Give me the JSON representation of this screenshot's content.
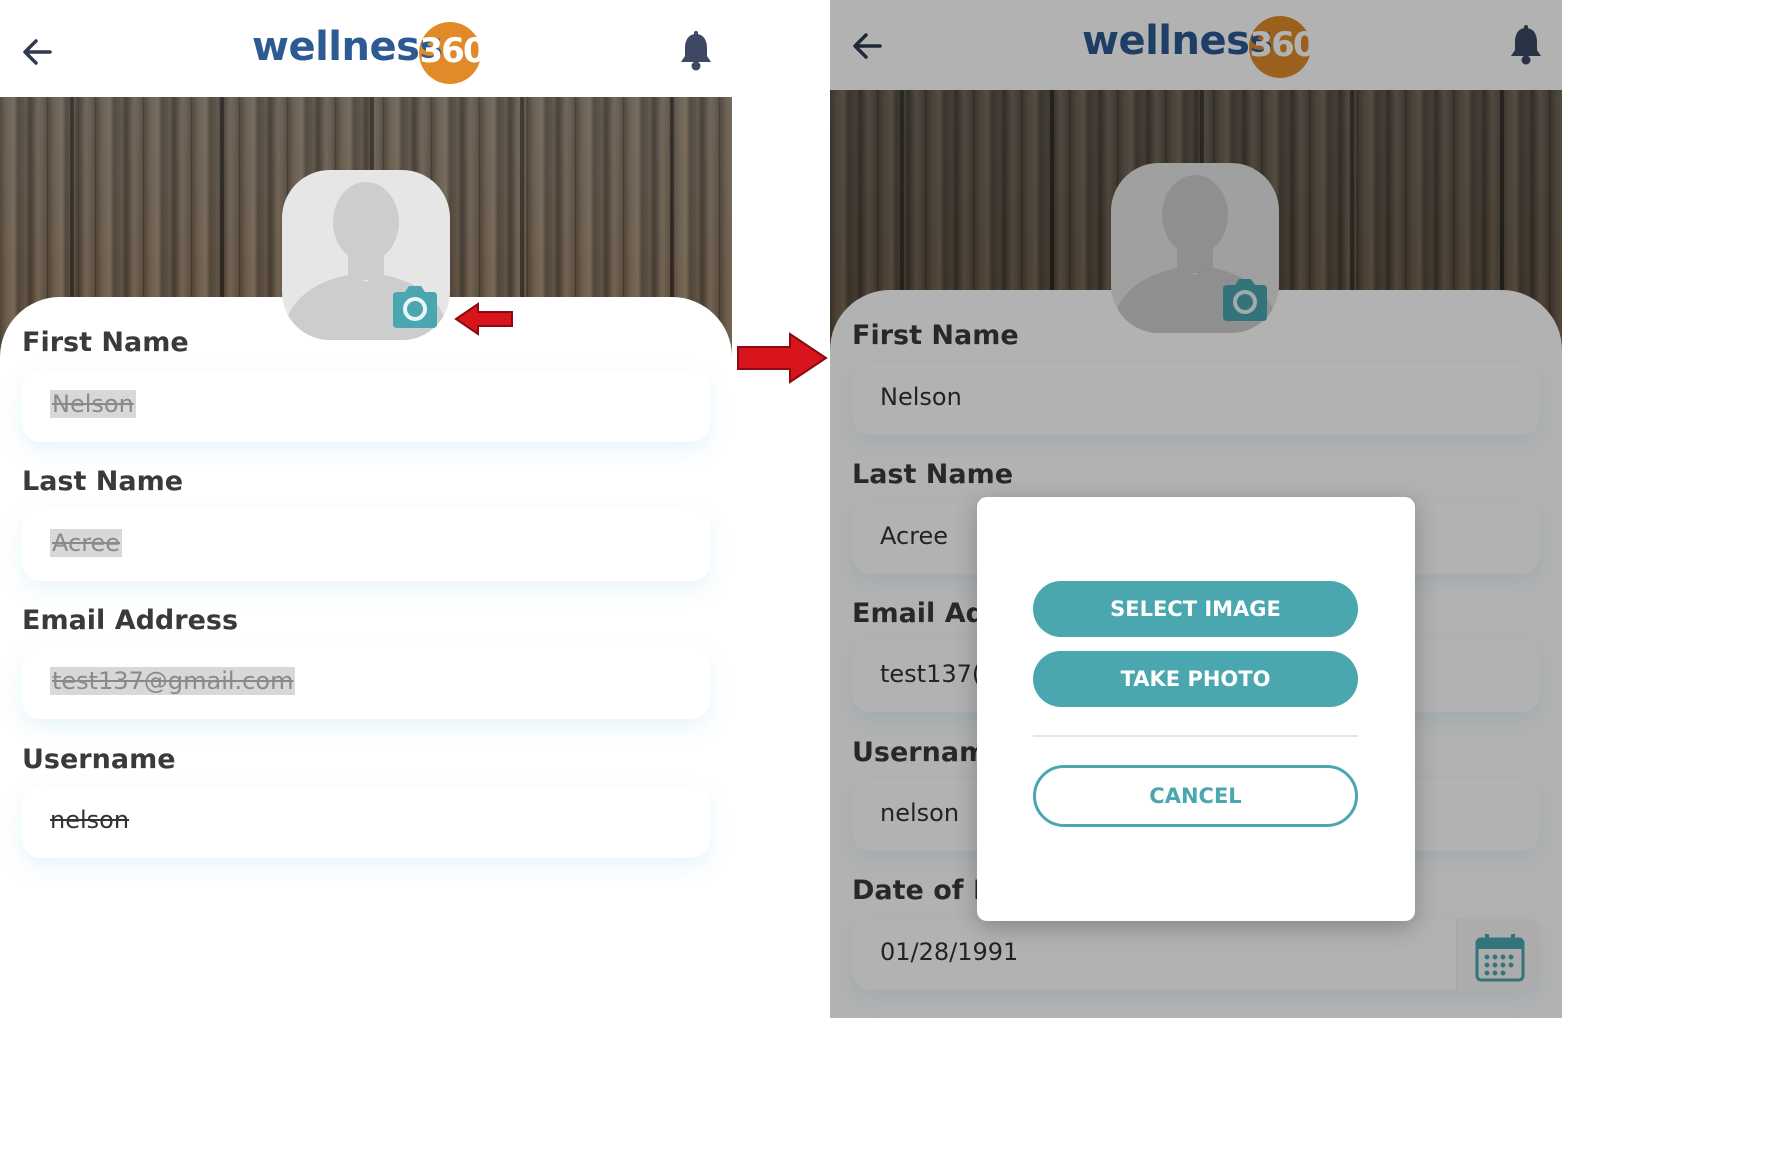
{
  "app": {
    "logo_word": "wellness",
    "logo_number": "360",
    "accent_color": "#4aa7b0",
    "logo_color": "#2d5a92",
    "logo_badge_color": "#e08a2a"
  },
  "icons": {
    "back": "back-arrow-icon",
    "notifications": "bell-icon",
    "camera": "camera-icon",
    "calendar": "calendar-icon"
  },
  "left_screen": {
    "fields": [
      {
        "label": "First Name",
        "value": "Nelson"
      },
      {
        "label": "Last Name",
        "value": "Acree"
      },
      {
        "label": "Email Address",
        "value": "test137@gmail.com"
      },
      {
        "label": "Username",
        "value": "nelson"
      }
    ]
  },
  "right_screen": {
    "fields": [
      {
        "label": "First Name",
        "value": "Nelson"
      },
      {
        "label": "Last Name",
        "value": "Acree"
      },
      {
        "label": "Email Ad",
        "value": "test137("
      },
      {
        "label": "Usernam",
        "value": "nelson"
      },
      {
        "label": "Date of E",
        "value": "01/28/1991"
      }
    ],
    "dialog": {
      "select_image": "SELECT IMAGE",
      "take_photo": "TAKE PHOTO",
      "cancel": "CANCEL"
    }
  }
}
